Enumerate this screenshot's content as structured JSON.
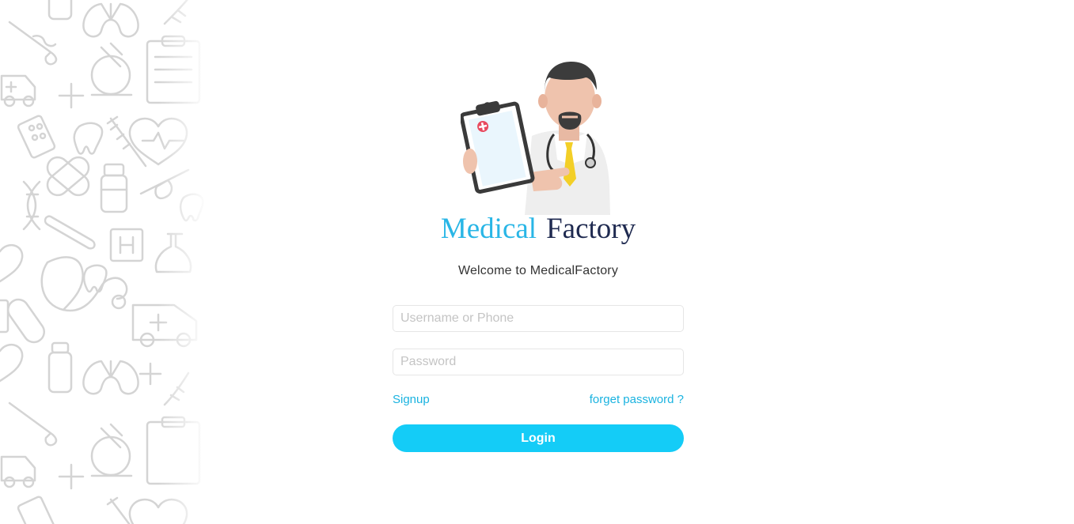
{
  "brand": {
    "part1": "Medical",
    "part2": "Factory",
    "accent_color": "#29b6e6",
    "dark_color": "#1f2a50"
  },
  "welcome_text": "Welcome to MedicalFactory",
  "form": {
    "username_placeholder": "Username or Phone",
    "username_value": "",
    "password_placeholder": "Password",
    "password_value": ""
  },
  "links": {
    "signup": "Signup",
    "forget_password": "forget password ?"
  },
  "login_button": {
    "label": "Login",
    "color": "#14ccf7"
  },
  "illustration": {
    "icon": "doctor-with-clipboard-icon"
  },
  "background": {
    "pattern": "medical-doodle-pattern-icon"
  }
}
